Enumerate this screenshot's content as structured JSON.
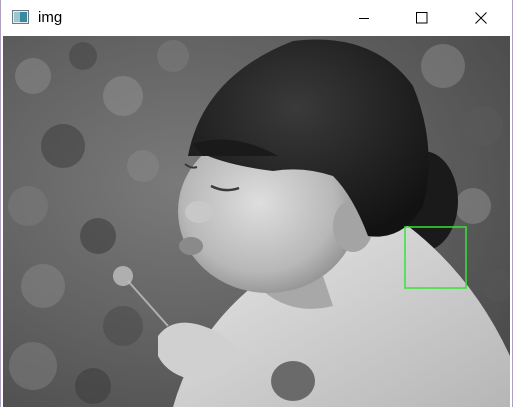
{
  "window": {
    "title": "img",
    "controls": {
      "minimize_icon": "minimize-icon",
      "maximize_icon": "maximize-icon",
      "close_icon": "close-icon"
    }
  },
  "image": {
    "mode": "grayscale",
    "overlay": {
      "shape": "rectangle",
      "color": "#33e633"
    }
  }
}
